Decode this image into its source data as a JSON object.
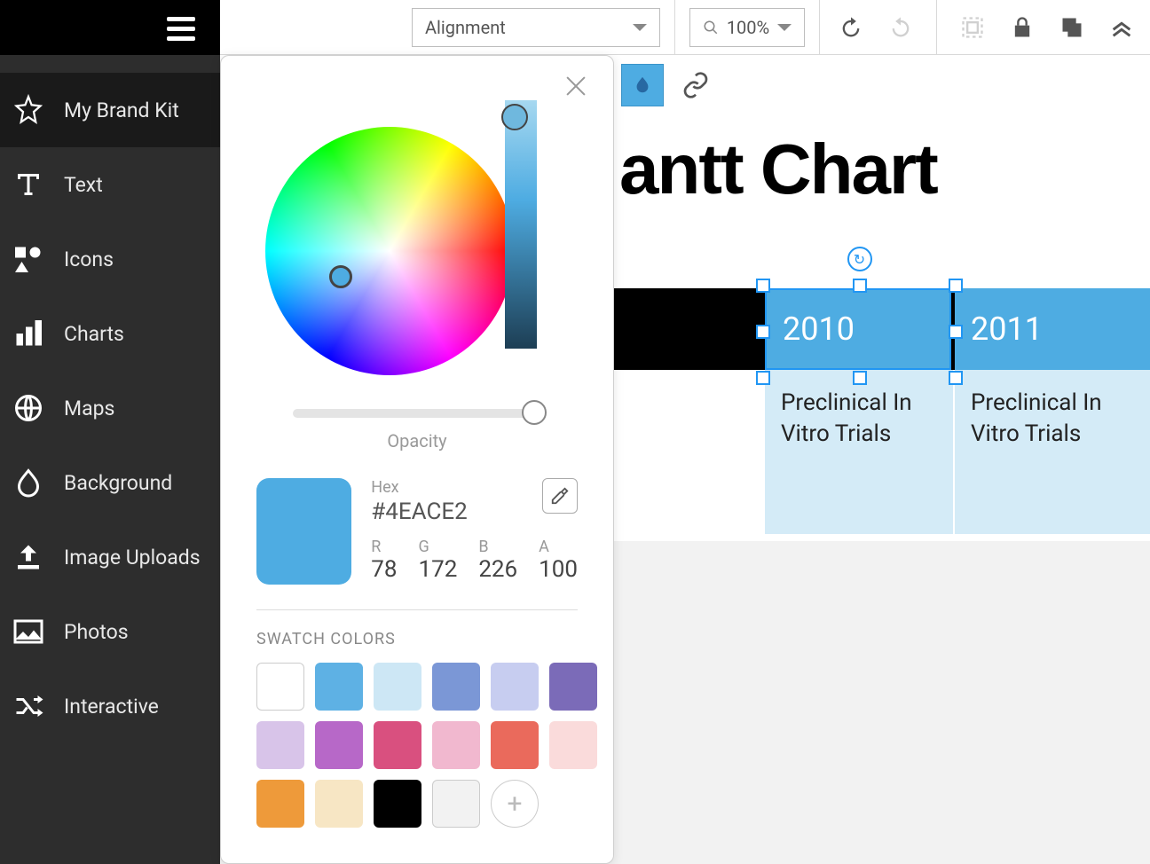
{
  "sidebar": {
    "items": [
      {
        "label": "My Brand Kit",
        "icon": "star-icon",
        "active": true
      },
      {
        "label": "Text",
        "icon": "text-icon"
      },
      {
        "label": "Icons",
        "icon": "shapes-icon"
      },
      {
        "label": "Charts",
        "icon": "bars-icon"
      },
      {
        "label": "Maps",
        "icon": "globe-icon"
      },
      {
        "label": "Background",
        "icon": "drop-icon"
      },
      {
        "label": "Image Uploads",
        "icon": "upload-icon"
      },
      {
        "label": "Photos",
        "icon": "photo-icon"
      },
      {
        "label": "Interactive",
        "icon": "shuffle-icon"
      }
    ]
  },
  "toolbar": {
    "alignment_label": "Alignment",
    "zoom_label": "100%"
  },
  "canvas": {
    "title_visible": "antt Chart",
    "cells": [
      {
        "year": "2010",
        "body": "Preclinical In Vitro Trials",
        "selected": true
      },
      {
        "year": "2011",
        "body": "Preclinical In Vitro Trials"
      }
    ]
  },
  "color_picker": {
    "opacity_label": "Opacity",
    "hex_label": "Hex",
    "hex_value": "#4EACE2",
    "channels": {
      "r_label": "R",
      "r": 78,
      "g_label": "G",
      "g": 172,
      "b_label": "B",
      "b": 226,
      "a_label": "A",
      "a": 100
    },
    "swatch_title": "SWATCH COLORS",
    "swatches": [
      "#ffffff",
      "#5eb1e4",
      "#cde7f5",
      "#7b97d6",
      "#c7cdf0",
      "#7b6bb8",
      "#d8c4e9",
      "#b768c8",
      "#d9507f",
      "#f1b8cf",
      "#ea6a5c",
      "#fadbdb",
      "#ee9a3a",
      "#f7e6c4",
      "#000000",
      "#f2f2f2"
    ]
  }
}
